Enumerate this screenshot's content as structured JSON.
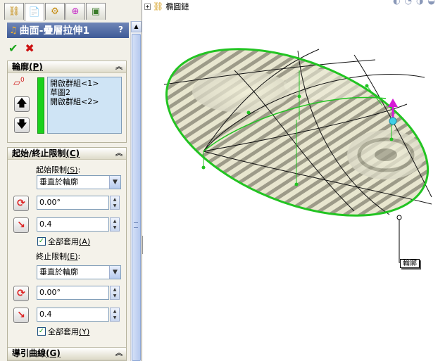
{
  "tabs": [
    {
      "name": "feature-manager",
      "icon": "feature-tree-icon"
    },
    {
      "name": "property-manager",
      "icon": "property-sheet-icon"
    },
    {
      "name": "configuration-manager",
      "icon": "configuration-icon"
    },
    {
      "name": "dimxpert-manager",
      "icon": "crosshair-icon"
    },
    {
      "name": "display-manager",
      "icon": "display-pane-icon"
    }
  ],
  "pm": {
    "title": "曲面-疊層拉伸1",
    "help": "?",
    "ok": "✔",
    "cancel": "✖"
  },
  "profile": {
    "header": "輪廓(P)",
    "header_text": "輪廓",
    "header_key": "(P)",
    "sel_badge": "0",
    "items": [
      "開啟群組<1>",
      "草圖2",
      "開啟群組<2>"
    ]
  },
  "constraints": {
    "header_text": "起始/終止限制",
    "header_key": "(C)",
    "start_label": "起始限制",
    "start_key": "(S)",
    "start_value": "垂直於輪廓",
    "start_angle": "0.00°",
    "start_length": "0.4",
    "start_apply_all": "全部套用",
    "start_apply_key": "(A)",
    "end_label": "終止限制",
    "end_key": "(E)",
    "end_value": "垂直於輪廓",
    "end_angle": "0.00°",
    "end_length": "0.4",
    "end_apply_all": "全部套用",
    "end_apply_key": "(Y)"
  },
  "guides": {
    "header_text": "導引曲線",
    "header_key": "(G)"
  },
  "viewport": {
    "tree_label": "橢圓鏈",
    "callout": "輪廓"
  },
  "colors": {
    "accent_title": "#3e5a96",
    "profile_edge": "#22c422",
    "handle_magenta": "#d61ad6",
    "handle_cyan": "#3fd0e6"
  }
}
